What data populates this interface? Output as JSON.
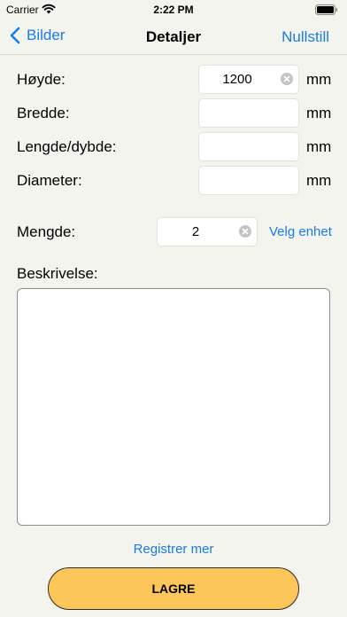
{
  "status": {
    "carrier": "Carrier",
    "time": "2:22 PM"
  },
  "nav": {
    "back_label": "Bilder",
    "title": "Detaljer",
    "reset_label": "Nullstill"
  },
  "fields": {
    "height": {
      "label": "Høyde:",
      "value": "1200",
      "unit": "mm"
    },
    "width": {
      "label": "Bredde:",
      "value": "",
      "unit": "mm"
    },
    "length": {
      "label": "Lengde/dybde:",
      "value": "",
      "unit": "mm"
    },
    "diameter": {
      "label": "Diameter:",
      "value": "",
      "unit": "mm"
    },
    "quantity": {
      "label": "Mengde:",
      "value": "2",
      "unit_link": "Velg enhet"
    }
  },
  "description": {
    "label": "Beskrivelse:",
    "value": ""
  },
  "actions": {
    "register_more": "Registrer mer",
    "save": "LAGRE"
  }
}
